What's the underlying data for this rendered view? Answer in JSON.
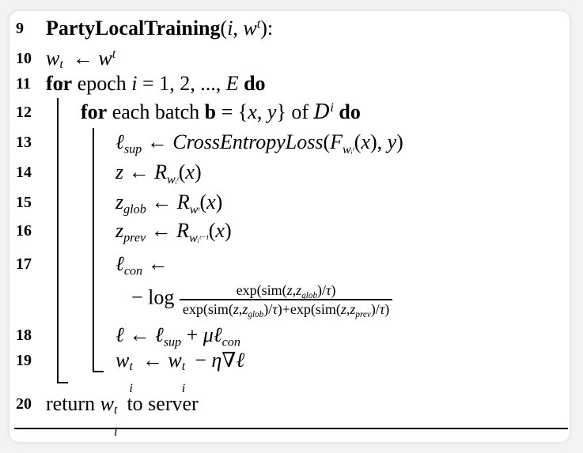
{
  "lines": [
    {
      "num": "9"
    },
    {
      "num": "10"
    },
    {
      "num": "11"
    },
    {
      "num": "12"
    },
    {
      "num": "13"
    },
    {
      "num": "14"
    },
    {
      "num": "15"
    },
    {
      "num": "16"
    },
    {
      "num": "17"
    },
    {
      "num": "18"
    },
    {
      "num": "19"
    },
    {
      "num": "20"
    }
  ],
  "text": {
    "func_name": "PartyLocalTraining",
    "for_kw": "for",
    "do_kw": "do",
    "epoch_word": "epoch",
    "each_batch": "each batch",
    "of_word": "of",
    "loss_name": "CrossEntropyLoss",
    "return_word": "return",
    "to_server": "to server",
    "exp_sim": "exp(sim(",
    "log_word": "log"
  }
}
